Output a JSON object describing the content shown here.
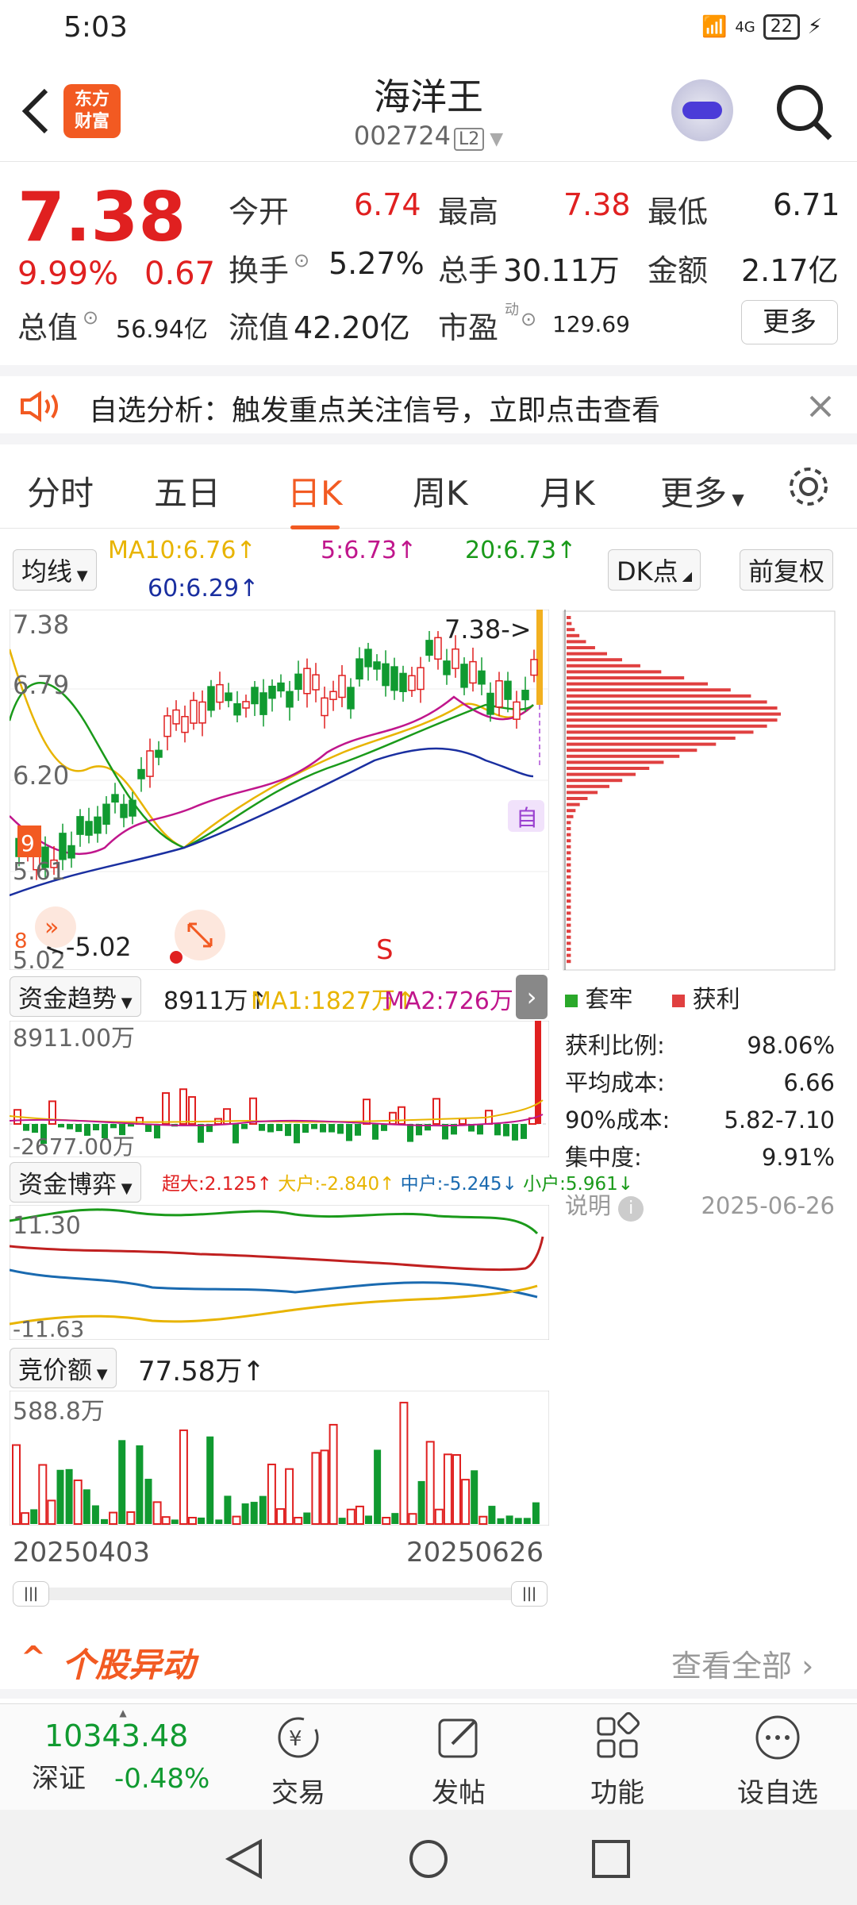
{
  "status": {
    "time": "5:03",
    "signal": "4G",
    "battery": "22"
  },
  "header": {
    "logo": "东方财富",
    "title": "海洋王",
    "code": "002724",
    "level": "L2"
  },
  "quote": {
    "price": "7.38",
    "pct": "9.99%",
    "change": "0.67",
    "open_label": "今开",
    "open": "6.74",
    "high_label": "最高",
    "high": "7.38",
    "low_label": "最低",
    "low": "6.71",
    "turnover_label": "换手",
    "turnover": "5.27%",
    "volume_label": "总手",
    "volume": "30.11万",
    "amount_label": "金额",
    "amount": "2.17亿",
    "mcap_label": "总值",
    "mcap": "56.94亿",
    "float_label": "流值",
    "float": "42.20亿",
    "pe_label": "市盈",
    "pe_sup": "动",
    "pe": "129.69",
    "more": "更多"
  },
  "notice": {
    "text": "自选分析：触发重点关注信号，立即点击查看"
  },
  "tabs": [
    "分时",
    "五日",
    "日K",
    "周K",
    "月K",
    "更多"
  ],
  "active_tab": "日K",
  "kline": {
    "ma_chip": "均线",
    "ma10": "MA10:6.76↑",
    "ma5": "5:6.73↑",
    "ma20": "20:6.73↑",
    "ma60": "60:6.29↑",
    "dk": "DK点",
    "fq": "前复权",
    "y_top": "7.38",
    "y_mid1": "6.79",
    "y_mid2": "6.20",
    "y_low": "5.61",
    "y_bottom": "5.02",
    "last_marker": "7.38->",
    "low_marker": "<-5.02",
    "s_marker": "S",
    "self_tag": "自",
    "badge9": "9",
    "badge8": "8"
  },
  "chip_dist": {
    "legend_trap": "套牢",
    "legend_profit": "获利",
    "rows": [
      {
        "label": "获利比例:",
        "value": "98.06%"
      },
      {
        "label": "平均成本:",
        "value": "6.66"
      },
      {
        "label": "90%成本:",
        "value": "5.82-7.10"
      },
      {
        "label": "集中度:",
        "value": "9.91%"
      }
    ],
    "note": "说明",
    "date": "2025-06-26"
  },
  "fund_trend": {
    "chip": "资金趋势",
    "value": "8911万↑",
    "ma1": "MA1:1827万↑",
    "ma2": "MA2:726万↑",
    "y_top": "8911.00万",
    "y_bottom": "-2677.00万"
  },
  "fund_game": {
    "chip": "资金博弈",
    "super": "超大:2.125↑",
    "big": "大户:-2.840↑",
    "mid": "中户:-5.245↓",
    "small": "小户:5.961↓",
    "y_top": "11.30",
    "y_bottom": "-11.63"
  },
  "auction": {
    "chip": "竞价额",
    "value": "77.58万↑",
    "y_top": "588.8万"
  },
  "dates": {
    "start": "20250403",
    "end": "20250626"
  },
  "abnormal": {
    "title": "个股异动",
    "link": "查看全部"
  },
  "bottom": {
    "index_value": "10343.48",
    "index_name": "深证",
    "index_pct": "-0.48%",
    "trade": "交易",
    "post": "发帖",
    "func": "功能",
    "fav": "设自选"
  },
  "colors": {
    "up": "#e02020",
    "down": "#109a30",
    "accent": "#f25a22",
    "ma5": "#c0168c",
    "ma10": "#e8b400",
    "ma20": "#1a9a1a",
    "ma60": "#1a2fa0"
  }
}
